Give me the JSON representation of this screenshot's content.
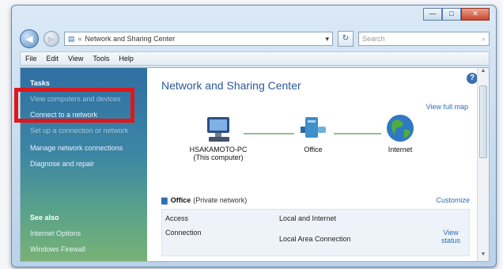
{
  "window": {
    "controls": {
      "minimize": "—",
      "maximize": "□",
      "close": "✕"
    }
  },
  "address_bar": {
    "back_icon": "back-arrow-icon",
    "forward_icon": "forward-arrow-icon",
    "crumb_sep": "«",
    "path": "Network and Sharing Center",
    "dropdown": "▾",
    "refresh": "↻"
  },
  "search": {
    "placeholder": "Search",
    "icon": "⌕"
  },
  "menu": [
    "File",
    "Edit",
    "View",
    "Tools",
    "Help"
  ],
  "sidebar": {
    "tasks_heading": "Tasks",
    "tasks": [
      {
        "label": "View computers and devices",
        "faded": true
      },
      {
        "label": "Connect to a network",
        "faded": false
      },
      {
        "label": "Set up a connection or network",
        "faded": true
      },
      {
        "label": "Manage network connections",
        "faded": false
      },
      {
        "label": "Diagnose and repair",
        "faded": false
      }
    ],
    "see_also_heading": "See also",
    "see_also": [
      "Internet Options",
      "Windows Firewall"
    ]
  },
  "main": {
    "title": "Network and Sharing Center",
    "help": "?",
    "view_full_map": "View full map",
    "nodes": [
      {
        "label": "HSAKAMOTO-PC",
        "sublabel": "(This computer)",
        "icon": "computer-icon"
      },
      {
        "label": "Office",
        "sublabel": "",
        "icon": "network-icon"
      },
      {
        "label": "Internet",
        "sublabel": "",
        "icon": "globe-icon"
      }
    ],
    "network": {
      "name": "Office",
      "type": "(Private network)",
      "customize": "Customize",
      "rows": [
        {
          "label": "Access",
          "value": "Local and Internet"
        },
        {
          "label": "Connection",
          "value": "Local Area Connection"
        }
      ],
      "view_status": "View status"
    }
  },
  "colors": {
    "highlight": "#e0161b",
    "accent": "#2a5a9b",
    "link": "#2d6cb8"
  }
}
